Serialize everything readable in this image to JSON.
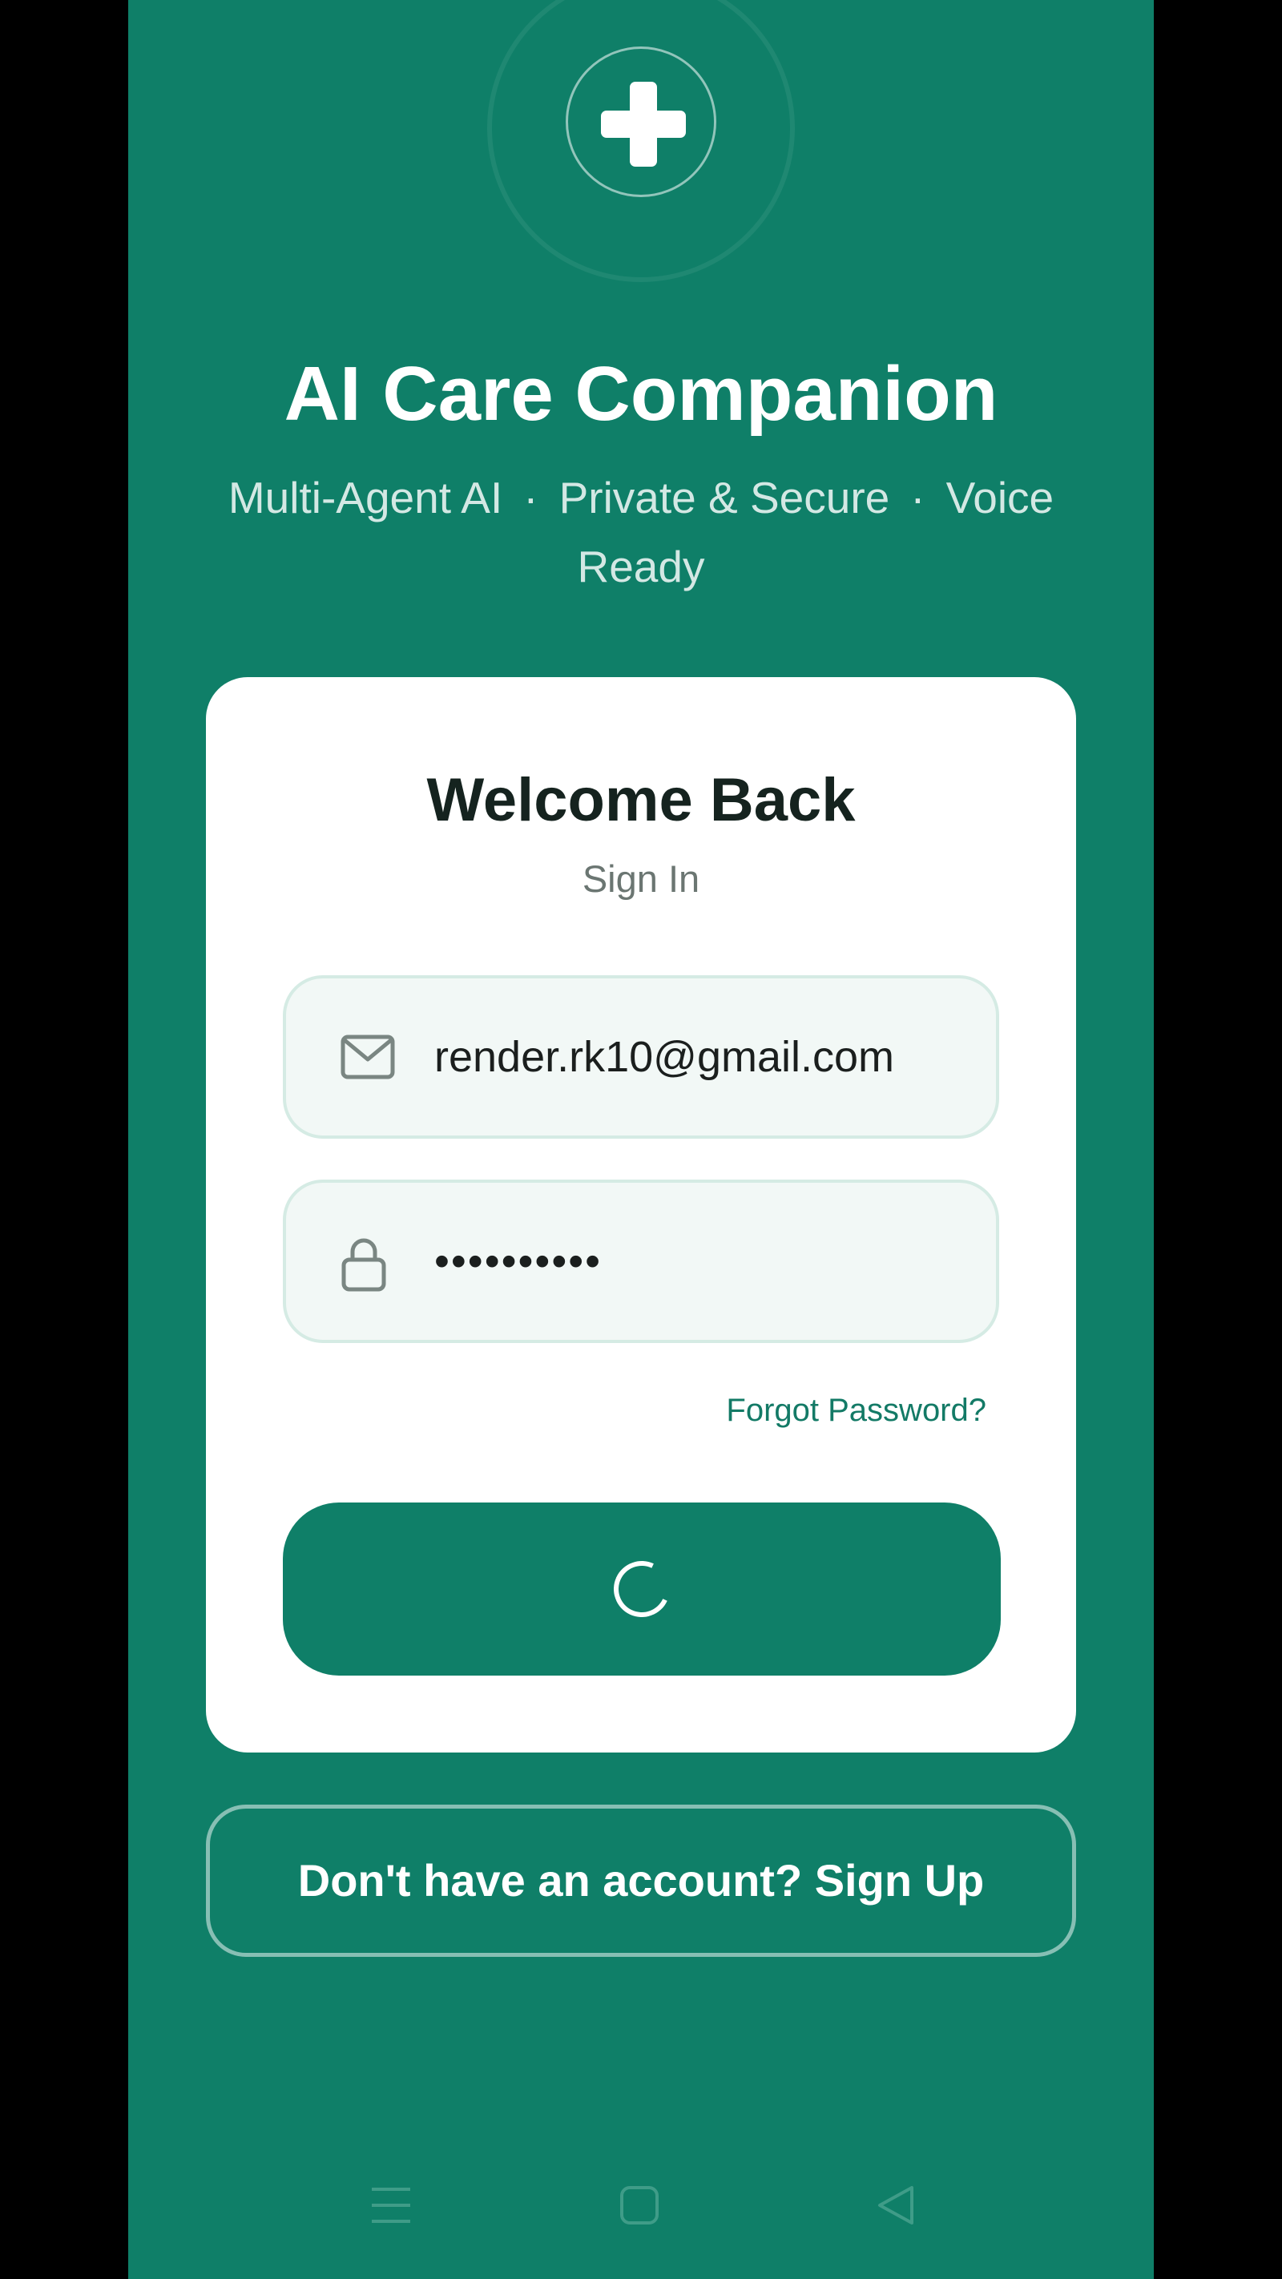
{
  "app": {
    "title": "AI Care Companion",
    "tagline": {
      "part1": "Multi-Agent AI",
      "part2": "Private & Secure",
      "part3": "Voice",
      "part4": "Ready",
      "separator": "·"
    }
  },
  "login_card": {
    "title": "Welcome Back",
    "subtitle": "Sign In",
    "email": {
      "value": "render.rk10@gmail.com",
      "icon": "mail-icon"
    },
    "password": {
      "value": "••••••••••",
      "icon": "lock-icon"
    },
    "forgot_label": "Forgot Password?",
    "submit_state": "loading"
  },
  "signup_label": "Don't have an account? Sign Up",
  "nav_bar": {
    "icons": [
      "menu-icon",
      "home-icon",
      "back-icon"
    ]
  },
  "colors": {
    "brand": "#0f7f68",
    "card": "#ffffff",
    "field_bg": "#f2f8f6",
    "link": "#137a66"
  }
}
